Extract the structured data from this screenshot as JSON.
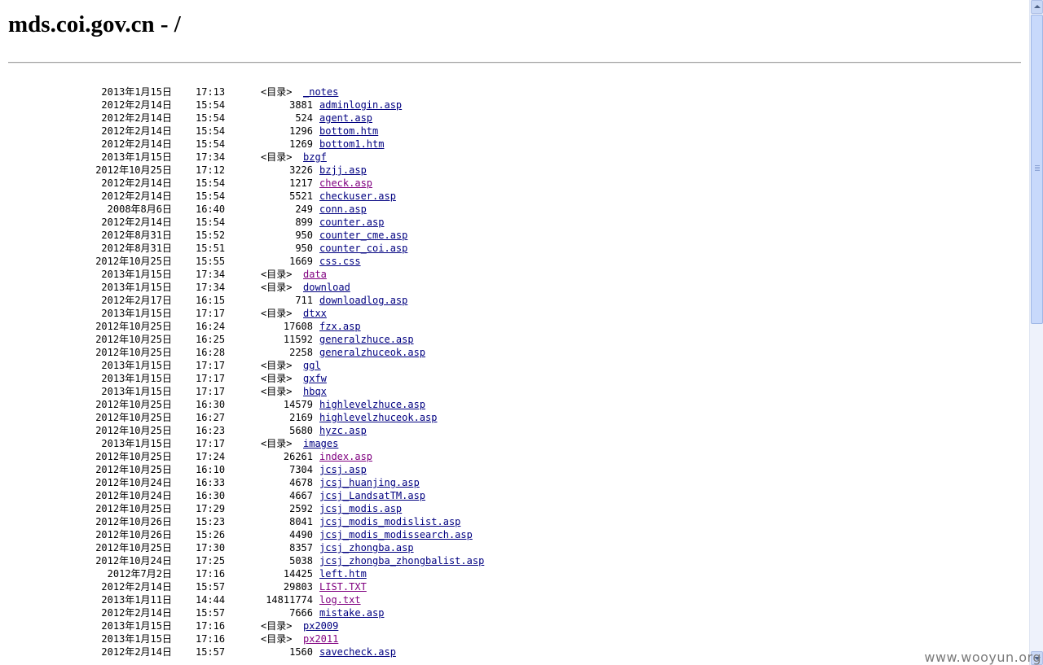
{
  "page": {
    "heading": "mds.coi.gov.cn - /"
  },
  "dir_tag": "<目录>",
  "entries": [
    {
      "date": "2013年1月15日",
      "time": "17:13",
      "size": "",
      "name": "_notes",
      "dir": true,
      "visited": false
    },
    {
      "date": "2012年2月14日",
      "time": "15:54",
      "size": "3881",
      "name": "adminlogin.asp",
      "dir": false,
      "visited": false
    },
    {
      "date": "2012年2月14日",
      "time": "15:54",
      "size": "524",
      "name": "agent.asp",
      "dir": false,
      "visited": false
    },
    {
      "date": "2012年2月14日",
      "time": "15:54",
      "size": "1296",
      "name": "bottom.htm",
      "dir": false,
      "visited": false
    },
    {
      "date": "2012年2月14日",
      "time": "15:54",
      "size": "1269",
      "name": "bottom1.htm",
      "dir": false,
      "visited": false
    },
    {
      "date": "2013年1月15日",
      "time": "17:34",
      "size": "",
      "name": "bzgf",
      "dir": true,
      "visited": false
    },
    {
      "date": "2012年10月25日",
      "time": "17:12",
      "size": "3226",
      "name": "bzjj.asp",
      "dir": false,
      "visited": false
    },
    {
      "date": "2012年2月14日",
      "time": "15:54",
      "size": "1217",
      "name": "check.asp",
      "dir": false,
      "visited": true
    },
    {
      "date": "2012年2月14日",
      "time": "15:54",
      "size": "5521",
      "name": "checkuser.asp",
      "dir": false,
      "visited": false
    },
    {
      "date": "2008年8月6日",
      "time": "16:40",
      "size": "249",
      "name": "conn.asp",
      "dir": false,
      "visited": false
    },
    {
      "date": "2012年2月14日",
      "time": "15:54",
      "size": "899",
      "name": "counter.asp",
      "dir": false,
      "visited": false
    },
    {
      "date": "2012年8月31日",
      "time": "15:52",
      "size": "950",
      "name": "counter_cme.asp",
      "dir": false,
      "visited": false
    },
    {
      "date": "2012年8月31日",
      "time": "15:51",
      "size": "950",
      "name": "counter_coi.asp",
      "dir": false,
      "visited": false
    },
    {
      "date": "2012年10月25日",
      "time": "15:55",
      "size": "1669",
      "name": "css.css",
      "dir": false,
      "visited": false
    },
    {
      "date": "2013年1月15日",
      "time": "17:34",
      "size": "",
      "name": "data",
      "dir": true,
      "visited": true
    },
    {
      "date": "2013年1月15日",
      "time": "17:34",
      "size": "",
      "name": "download",
      "dir": true,
      "visited": false
    },
    {
      "date": "2012年2月17日",
      "time": "16:15",
      "size": "711",
      "name": "downloadlog.asp",
      "dir": false,
      "visited": false
    },
    {
      "date": "2013年1月15日",
      "time": "17:17",
      "size": "",
      "name": "dtxx",
      "dir": true,
      "visited": false
    },
    {
      "date": "2012年10月25日",
      "time": "16:24",
      "size": "17608",
      "name": "fzx.asp",
      "dir": false,
      "visited": false
    },
    {
      "date": "2012年10月25日",
      "time": "16:25",
      "size": "11592",
      "name": "generalzhuce.asp",
      "dir": false,
      "visited": false
    },
    {
      "date": "2012年10月25日",
      "time": "16:28",
      "size": "2258",
      "name": "generalzhuceok.asp",
      "dir": false,
      "visited": false
    },
    {
      "date": "2013年1月15日",
      "time": "17:17",
      "size": "",
      "name": "ggl",
      "dir": true,
      "visited": false
    },
    {
      "date": "2013年1月15日",
      "time": "17:17",
      "size": "",
      "name": "gxfw",
      "dir": true,
      "visited": false
    },
    {
      "date": "2013年1月15日",
      "time": "17:17",
      "size": "",
      "name": "hbqx",
      "dir": true,
      "visited": false
    },
    {
      "date": "2012年10月25日",
      "time": "16:30",
      "size": "14579",
      "name": "highlevelzhuce.asp",
      "dir": false,
      "visited": false
    },
    {
      "date": "2012年10月25日",
      "time": "16:27",
      "size": "2169",
      "name": "highlevelzhuceok.asp",
      "dir": false,
      "visited": false
    },
    {
      "date": "2012年10月25日",
      "time": "16:23",
      "size": "5680",
      "name": "hyzc.asp",
      "dir": false,
      "visited": false
    },
    {
      "date": "2013年1月15日",
      "time": "17:17",
      "size": "",
      "name": "images",
      "dir": true,
      "visited": false
    },
    {
      "date": "2012年10月25日",
      "time": "17:24",
      "size": "26261",
      "name": "index.asp",
      "dir": false,
      "visited": true
    },
    {
      "date": "2012年10月25日",
      "time": "16:10",
      "size": "7304",
      "name": "jcsj.asp",
      "dir": false,
      "visited": false
    },
    {
      "date": "2012年10月24日",
      "time": "16:33",
      "size": "4678",
      "name": "jcsj_huanjing.asp",
      "dir": false,
      "visited": false
    },
    {
      "date": "2012年10月24日",
      "time": "16:30",
      "size": "4667",
      "name": "jcsj_LandsatTM.asp",
      "dir": false,
      "visited": false
    },
    {
      "date": "2012年10月25日",
      "time": "17:29",
      "size": "2592",
      "name": "jcsj_modis.asp",
      "dir": false,
      "visited": false
    },
    {
      "date": "2012年10月26日",
      "time": "15:23",
      "size": "8041",
      "name": "jcsj_modis_modislist.asp",
      "dir": false,
      "visited": false
    },
    {
      "date": "2012年10月26日",
      "time": "15:26",
      "size": "4490",
      "name": "jcsj_modis_modissearch.asp",
      "dir": false,
      "visited": false
    },
    {
      "date": "2012年10月25日",
      "time": "17:30",
      "size": "8357",
      "name": "jcsj_zhongba.asp",
      "dir": false,
      "visited": false
    },
    {
      "date": "2012年10月24日",
      "time": "17:25",
      "size": "5038",
      "name": "jcsj_zhongba_zhongbalist.asp",
      "dir": false,
      "visited": false
    },
    {
      "date": "2012年7月2日",
      "time": "17:16",
      "size": "14425",
      "name": "left.htm",
      "dir": false,
      "visited": false
    },
    {
      "date": "2012年2月14日",
      "time": "15:57",
      "size": "29803",
      "name": "LIST.TXT",
      "dir": false,
      "visited": true
    },
    {
      "date": "2013年1月11日",
      "time": "14:44",
      "size": "14811774",
      "name": "log.txt",
      "dir": false,
      "visited": true
    },
    {
      "date": "2012年2月14日",
      "time": "15:57",
      "size": "7666",
      "name": "mistake.asp",
      "dir": false,
      "visited": false
    },
    {
      "date": "2013年1月15日",
      "time": "17:16",
      "size": "",
      "name": "px2009",
      "dir": true,
      "visited": false
    },
    {
      "date": "2013年1月15日",
      "time": "17:16",
      "size": "",
      "name": "px2011",
      "dir": true,
      "visited": true
    },
    {
      "date": "2012年2月14日",
      "time": "15:57",
      "size": "1560",
      "name": "savecheck.asp",
      "dir": false,
      "visited": false
    }
  ],
  "watermark": "www.wooyun.org",
  "colors": {
    "link": "#000080",
    "visited": "#800080",
    "rule": "#a0a0a0"
  }
}
